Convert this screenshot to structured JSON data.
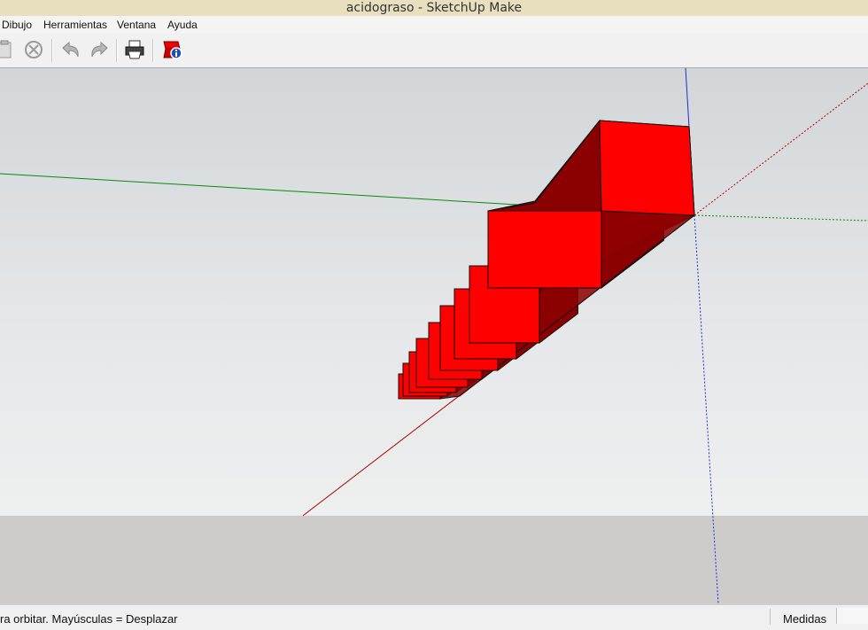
{
  "window": {
    "title": "acidograso - SketchUp Make"
  },
  "menu": {
    "items": [
      "Dibujo",
      "Herramientas",
      "Ventana",
      "Ayuda"
    ]
  },
  "toolbar": {
    "buttons": [
      {
        "icon": "paste-icon"
      },
      {
        "icon": "erase-icon"
      },
      {
        "icon": "undo-icon"
      },
      {
        "icon": "redo-icon"
      },
      {
        "icon": "print-icon"
      },
      {
        "icon": "model-info-icon"
      }
    ]
  },
  "status": {
    "hint": "ra orbitar. Mayúsculas = Desplazar",
    "measurements_label": "Medidas",
    "measurements_value": ""
  },
  "colors": {
    "axis_red": "#b30000",
    "axis_green": "#0a8a0a",
    "axis_blue": "#1a2fcc",
    "face_front": "#ff0000",
    "face_side": "#8b0000",
    "edge": "#111111"
  }
}
